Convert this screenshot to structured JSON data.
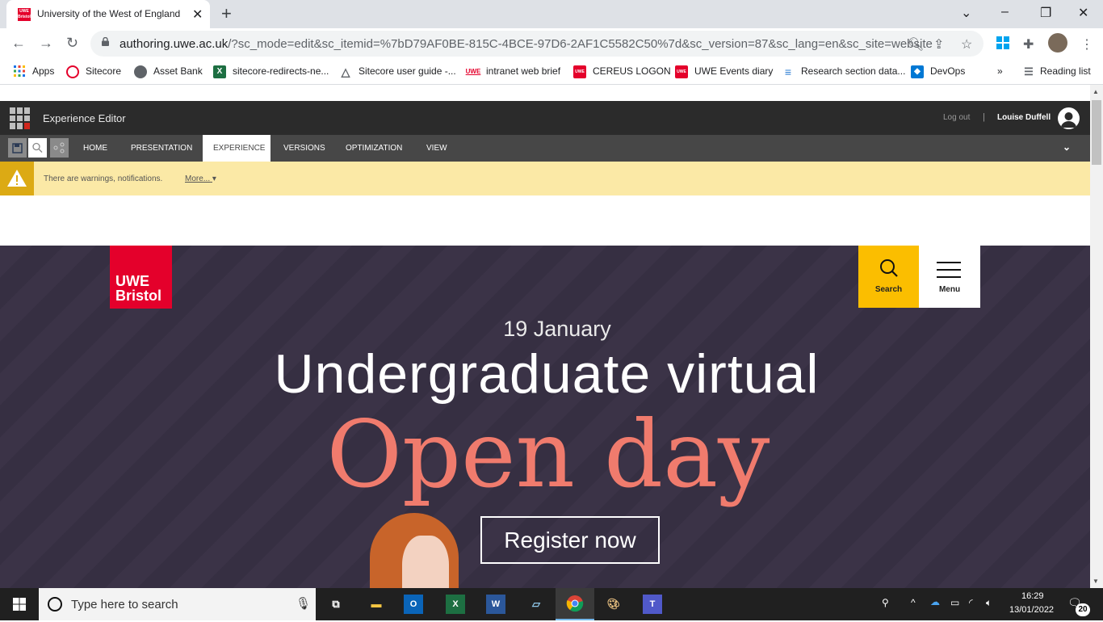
{
  "browser": {
    "tab_title": "University of the West of England Bristol",
    "tab_favicon_text": "UWE Bristol",
    "url_host": "authoring.uwe.ac.uk",
    "url_rest": "/?sc_mode=edit&sc_itemid=%7bD79AF0BE-815C-4BCE-97D6-2AF1C5582C50%7d&sc_version=87&sc_lang=en&sc_site=website",
    "bookmarks": [
      {
        "label": "Apps"
      },
      {
        "label": "Sitecore"
      },
      {
        "label": "Asset Bank"
      },
      {
        "label": "sitecore-redirects-ne..."
      },
      {
        "label": "Sitecore user guide -..."
      },
      {
        "label": "intranet web brief"
      },
      {
        "label": "CEREUS LOGON"
      },
      {
        "label": "UWE Events diary"
      },
      {
        "label": "Research section data..."
      },
      {
        "label": "DevOps"
      }
    ],
    "more_bookmarks": "»",
    "reading_list": "Reading list"
  },
  "sitecore": {
    "app_name": "Experience Editor",
    "logout": "Log out",
    "separator": "|",
    "user_name": "Louise Duffell",
    "tabs": [
      "HOME",
      "PRESENTATION",
      "EXPERIENCE",
      "VERSIONS",
      "OPTIMIZATION",
      "VIEW"
    ],
    "active_tab": "EXPERIENCE",
    "warning_text": "There are warnings, notifications.",
    "warning_more": "More..."
  },
  "page": {
    "logo_line1": "UWE",
    "logo_line2": "Bristol",
    "search_label": "Search",
    "menu_label": "Menu",
    "date": "19 January",
    "headline": "Undergraduate virtual",
    "open_day": "Open day",
    "register": "Register now",
    "colors": {
      "brand_red": "#e4002b",
      "search_yellow": "#fbbe00",
      "coral": "#f07b6d",
      "hero_bg": "#3b3347"
    }
  },
  "taskbar": {
    "search_placeholder": "Type here to search",
    "time": "16:29",
    "date": "13/01/2022",
    "notifications_count": "20"
  }
}
